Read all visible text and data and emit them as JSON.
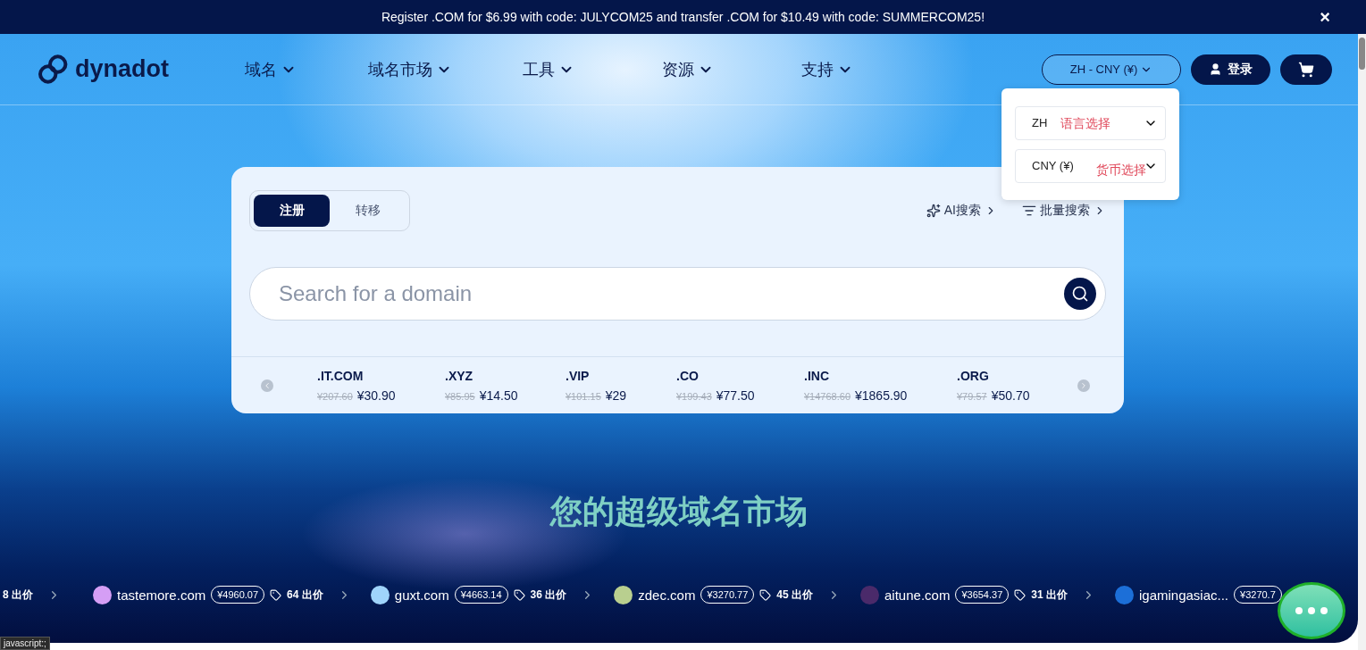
{
  "promo_banner": {
    "text": "Register .COM for $6.99 with code: JULYCOM25 and transfer .COM for $10.49 with code: SUMMERCOM25!",
    "close": "×"
  },
  "header": {
    "logo": "dynadot",
    "nav": [
      {
        "label": "域名"
      },
      {
        "label": "域名市场"
      },
      {
        "label": "工具"
      },
      {
        "label": "资源"
      },
      {
        "label": "支持"
      }
    ],
    "locale_button": "ZH - CNY (¥)",
    "login_button": "登录"
  },
  "locale_menu": {
    "expanded": true,
    "fields": [
      {
        "value": "ZH",
        "annotation": "语言选择"
      },
      {
        "value": "CNY (¥)",
        "annotation": "货币选择"
      }
    ]
  },
  "search_card": {
    "tabs": [
      {
        "label": "注册",
        "selected": true
      },
      {
        "label": "转移",
        "selected": false
      }
    ],
    "links": [
      {
        "kind": "ai",
        "label": "AI搜索"
      },
      {
        "kind": "bulk",
        "label": "批量搜索"
      }
    ],
    "search": {
      "placeholder": "Search for a domain"
    },
    "tlds": [
      {
        "name": ".IT.COM",
        "old_price": "¥207.60",
        "price": "¥30.90"
      },
      {
        "name": ".XYZ",
        "old_price": "¥85.95",
        "price": "¥14.50"
      },
      {
        "name": ".VIP",
        "old_price": "¥101.15",
        "price": "¥29"
      },
      {
        "name": ".CO",
        "old_price": "¥199.43",
        "price": "¥77.50"
      },
      {
        "name": ".INC",
        "old_price": "¥14768.60",
        "price": "¥1865.90"
      },
      {
        "name": ".ORG",
        "old_price": "¥79.57",
        "price": "¥50.70"
      }
    ]
  },
  "headline": "您的超级域名市场",
  "marketplace_ticker": [
    {
      "offers": "8 出价"
    },
    {
      "name": "tastemore.com",
      "color": "#d59ef5",
      "price": "¥4960.07",
      "offers": "64 出价"
    },
    {
      "name": "guxt.com",
      "color": "#9fd4fb",
      "price": "¥4663.14",
      "offers": "36 出价"
    },
    {
      "name": "zdec.com",
      "color": "#b9cf8f",
      "price": "¥3270.77",
      "offers": "45 出价"
    },
    {
      "name": "aitune.com",
      "color": "#4a2a6a",
      "price": "¥3654.37",
      "offers": "31 出价"
    },
    {
      "name": "igamingasiac...",
      "color": "#1c6fd8",
      "price": "¥3270.7"
    }
  ],
  "status_bar": "javascript:;"
}
